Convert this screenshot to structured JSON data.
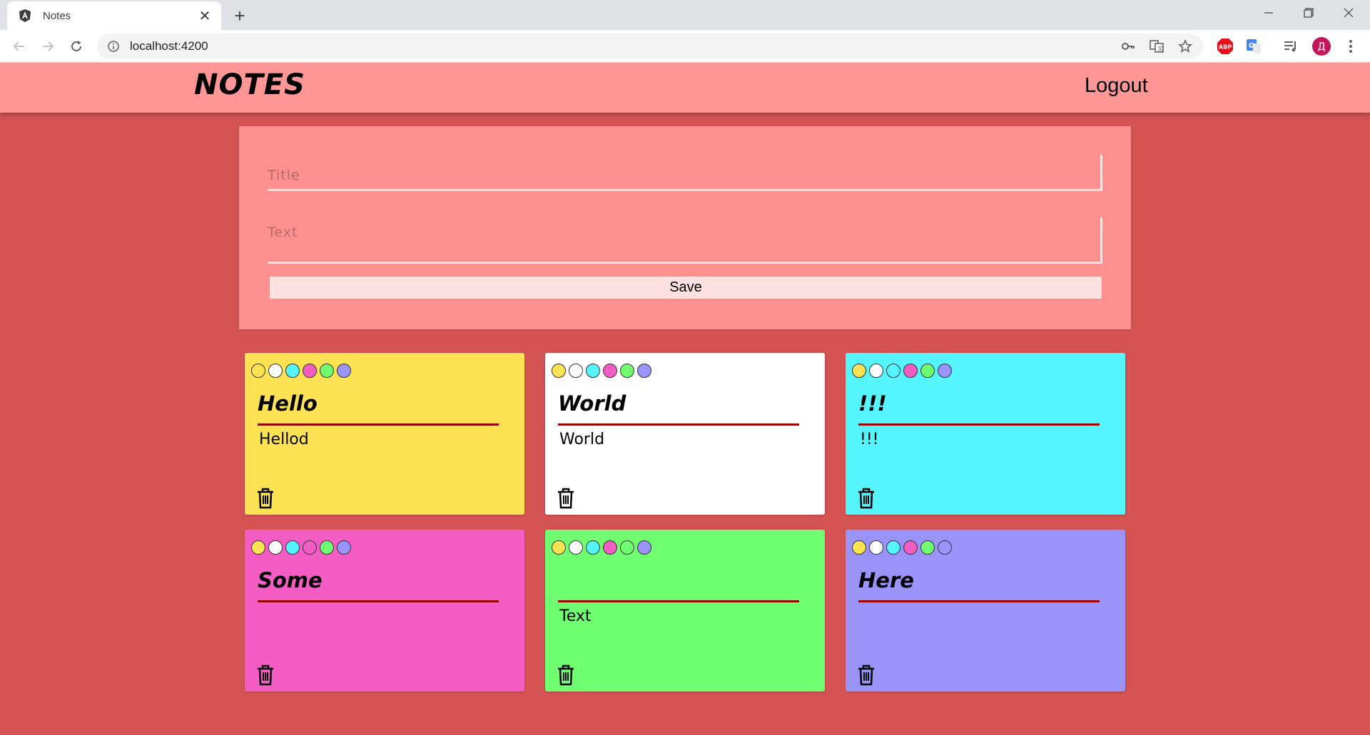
{
  "browser": {
    "tab_title": "Notes",
    "url": "localhost:4200"
  },
  "app": {
    "logo": "NOTES",
    "logout": "Logout"
  },
  "form": {
    "title_placeholder": "Title",
    "text_placeholder": "Text",
    "save_label": "Save"
  },
  "palette": [
    "#fde254",
    "#ffffff",
    "#56f4fd",
    "#f45dc4",
    "#70ff70",
    "#9a93fa"
  ],
  "notes": [
    {
      "title": "Hello",
      "text": "Hellod",
      "color": "#fde254"
    },
    {
      "title": "World",
      "text": "World",
      "color": "#ffffff"
    },
    {
      "title": "!!!",
      "text": "!!!",
      "color": "#56f4fd"
    },
    {
      "title": "Some",
      "text": "",
      "color": "#f45dc4"
    },
    {
      "title": "",
      "text": "Text",
      "color": "#70ff70"
    },
    {
      "title": "Here",
      "text": "",
      "color": "#9a93fa"
    }
  ]
}
